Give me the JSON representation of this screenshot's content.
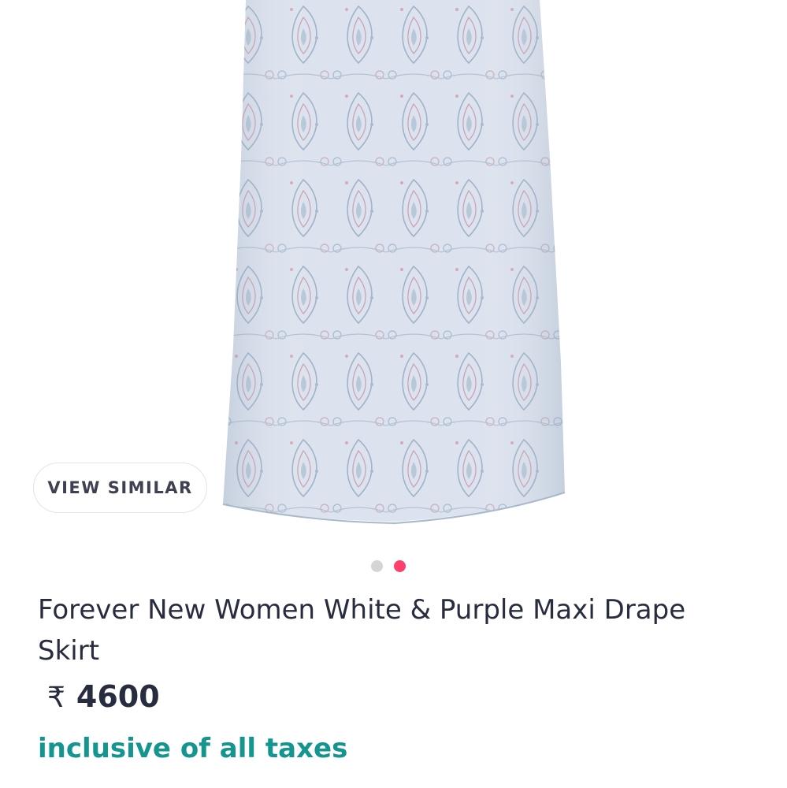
{
  "gallery": {
    "image_alt": "Forever New Women White & Purple Maxi Drape Skirt",
    "view_similar_label": "VIEW SIMILAR",
    "pager_total": 2,
    "pager_active": 2,
    "colors": {
      "dot_inactive": "#d4d5d9",
      "dot_active": "#ff3f6c"
    }
  },
  "product": {
    "title": "Forever New Women White & Purple Maxi Drape Skirt",
    "currency_symbol": "₹",
    "price": "4600",
    "tax_note": "inclusive of all taxes"
  },
  "colors": {
    "text": "#282c3f",
    "tax_note": "#14958f"
  }
}
